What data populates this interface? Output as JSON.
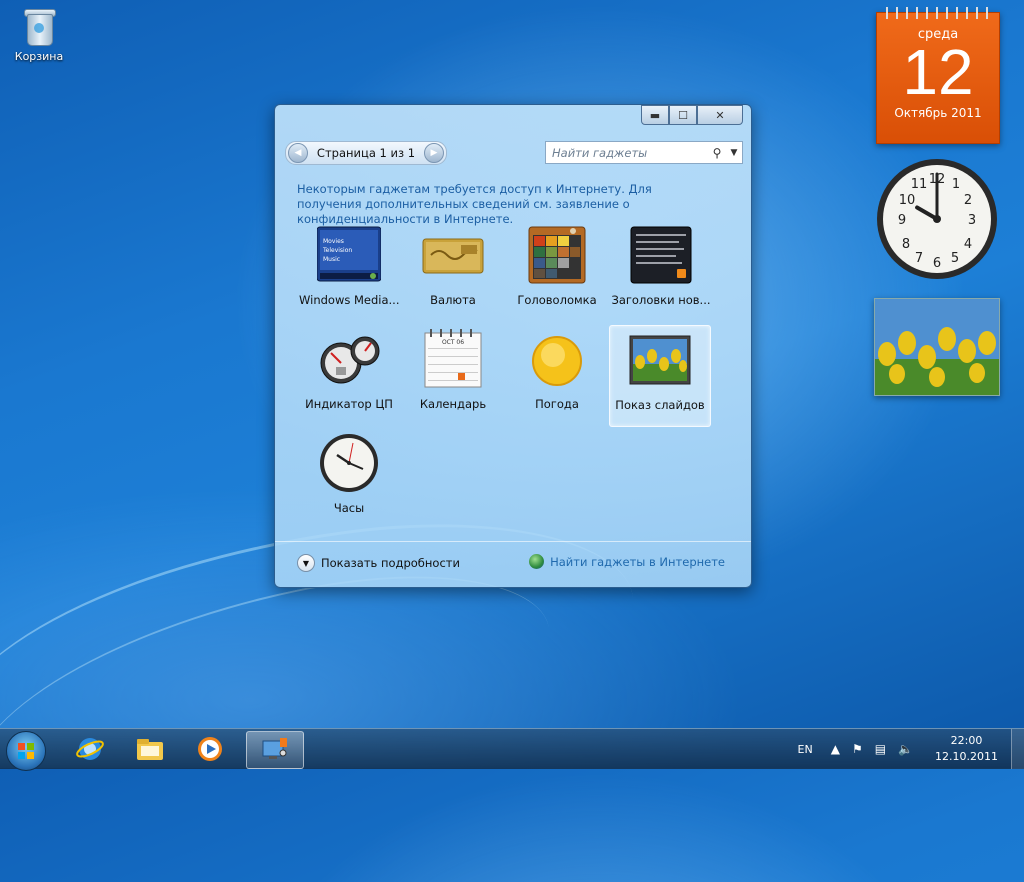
{
  "desktop": {
    "icons": [
      {
        "label": "Корзина",
        "icon": "recycle-bin-icon"
      }
    ]
  },
  "side_gadgets": {
    "calendar": {
      "weekday": "среда",
      "day": "12",
      "month_year": "Октябрь 2011",
      "color": "#e85d0f"
    },
    "clock": {
      "hours": 10,
      "minutes": 0
    },
    "slideshow": {
      "image": "tulips-photo"
    }
  },
  "dialog": {
    "window_controls": {
      "minimize": "▬",
      "maximize": "☐",
      "close": "✕"
    },
    "pager": {
      "prev": "◀",
      "text": "Страница 1 из 1",
      "next": "▶"
    },
    "search": {
      "placeholder": "Найти гаджеты",
      "icon": "search-icon"
    },
    "notice": "Некоторым гаджетам требуется доступ к Интернету. Для получения дополнительных сведений см. заявление о конфиденциальности в Интернете.",
    "gadgets": [
      {
        "label": "Windows Media...",
        "icon": "windows-media-center-icon",
        "thumb_lines": [
          "Movies",
          "Television",
          "Music"
        ]
      },
      {
        "label": "Валюта",
        "icon": "currency-icon"
      },
      {
        "label": "Головоломка",
        "icon": "puzzle-icon"
      },
      {
        "label": "Заголовки нов...",
        "icon": "feed-headlines-icon"
      },
      {
        "label": "Индикатор ЦП",
        "icon": "cpu-meter-icon"
      },
      {
        "label": "Календарь",
        "icon": "calendar-icon",
        "thumb_month": "OCT 06"
      },
      {
        "label": "Погода",
        "icon": "weather-icon"
      },
      {
        "label": "Показ слайдов",
        "icon": "slideshow-icon",
        "selected": true
      },
      {
        "label": "Часы",
        "icon": "clock-icon"
      }
    ],
    "footer": {
      "details_label": "Показать подробности",
      "online_label": "Найти гаджеты в Интернете"
    }
  },
  "taskbar": {
    "pinned": [
      "internet-explorer-icon",
      "windows-explorer-icon",
      "media-player-icon",
      "gadgets-icon"
    ],
    "active": "gadgets-icon",
    "tray": {
      "language": "EN",
      "time": "22:00",
      "date": "12.10.2011"
    }
  }
}
